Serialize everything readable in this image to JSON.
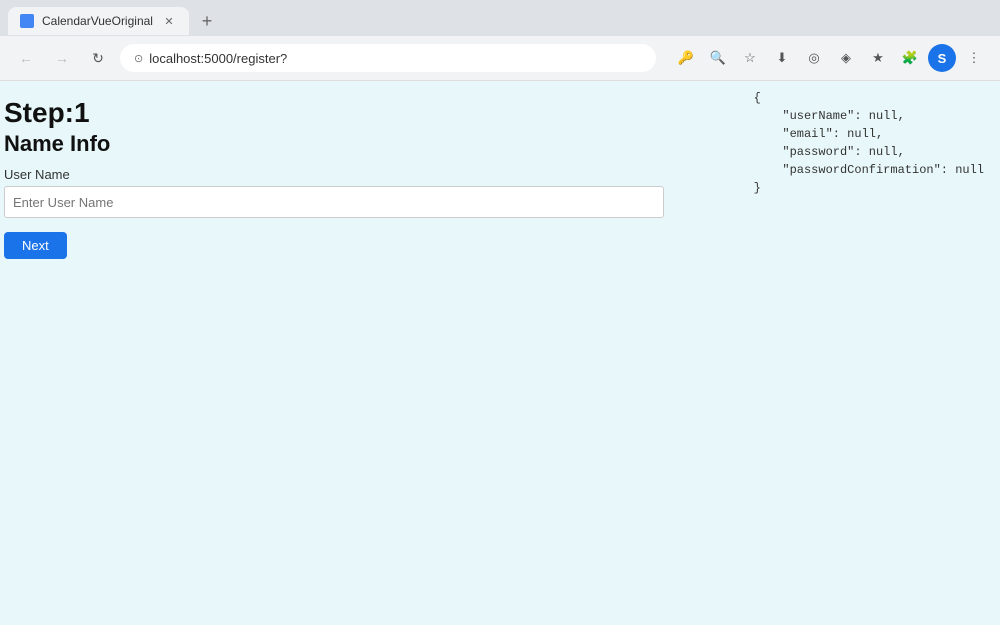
{
  "browser": {
    "tab_title": "CalendarVueOriginal",
    "url": "localhost:5000/register?",
    "new_tab_icon": "+",
    "back_icon": "←",
    "forward_icon": "→",
    "refresh_icon": "↻",
    "profile_letter": "S"
  },
  "page": {
    "step_label": "Step:1",
    "section_title": "Name Info",
    "field_label": "User Name",
    "input_placeholder": "Enter User Name",
    "input_value": "",
    "next_button_label": "Next"
  },
  "json_preview": {
    "line1": "{",
    "line2": "    \"userName\": null,",
    "line3": "    \"email\": null,",
    "line4": "    \"password\": null,",
    "line5": "    \"passwordConfirmation\": null",
    "line6": "}"
  }
}
